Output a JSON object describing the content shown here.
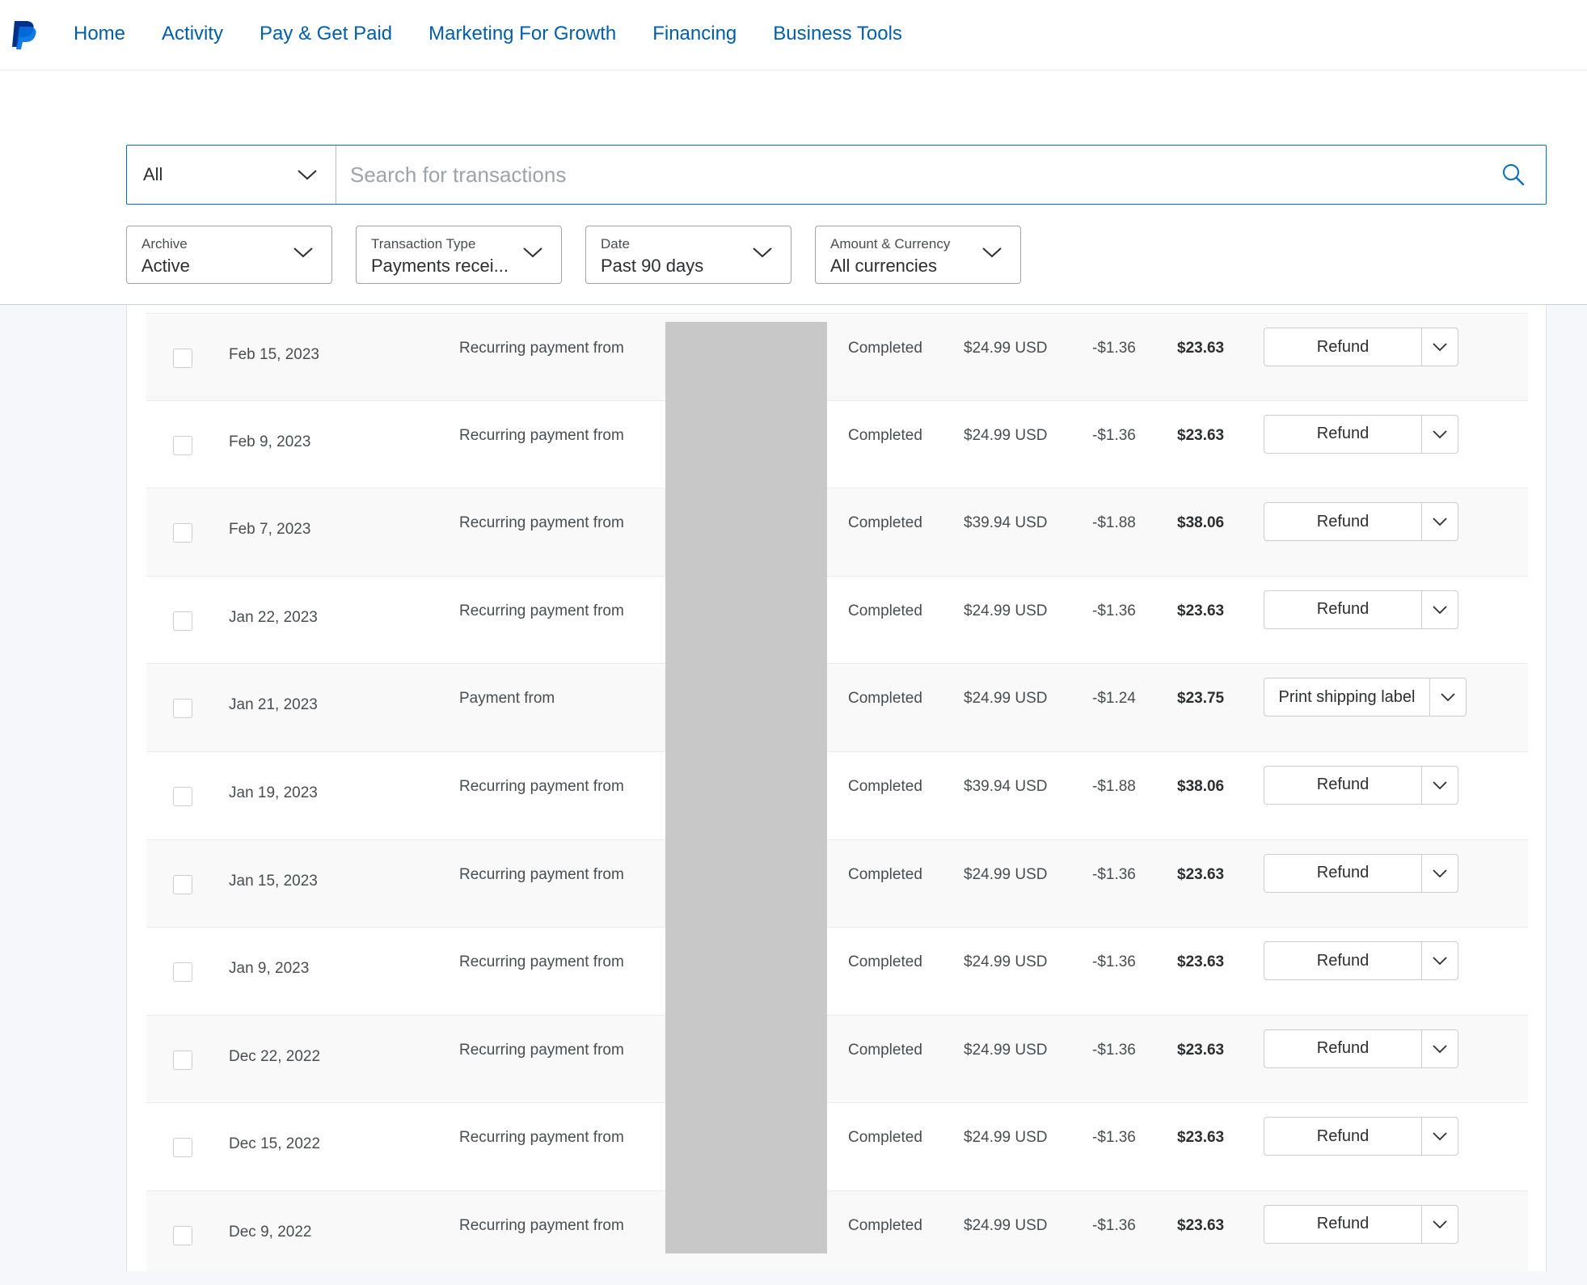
{
  "nav": {
    "logo": "paypal-logo",
    "links": [
      "Home",
      "Activity",
      "Pay & Get Paid",
      "Marketing For Growth",
      "Financing",
      "Business Tools"
    ]
  },
  "search": {
    "scope": "All",
    "placeholder": "Search for transactions"
  },
  "filters": [
    {
      "label": "Archive",
      "value": "Active"
    },
    {
      "label": "Transaction Type",
      "value": "Payments recei..."
    },
    {
      "label": "Date",
      "value": "Past 90 days"
    },
    {
      "label": "Amount & Currency",
      "value": "All currencies"
    }
  ],
  "colors": {
    "link": "#005ea6",
    "accent": "#0070ba",
    "redaction": "#c8c8c8"
  },
  "transactions": [
    {
      "date": "Feb 15, 2023",
      "description": "Recurring payment from",
      "status": "Completed",
      "gross": "$24.99 USD",
      "fee": "-$1.36",
      "net": "$23.63",
      "action": "Refund"
    },
    {
      "date": "Feb 9, 2023",
      "description": "Recurring payment from",
      "status": "Completed",
      "gross": "$24.99 USD",
      "fee": "-$1.36",
      "net": "$23.63",
      "action": "Refund"
    },
    {
      "date": "Feb 7, 2023",
      "description": "Recurring payment from",
      "status": "Completed",
      "gross": "$39.94 USD",
      "fee": "-$1.88",
      "net": "$38.06",
      "action": "Refund"
    },
    {
      "date": "Jan 22, 2023",
      "description": "Recurring payment from",
      "status": "Completed",
      "gross": "$24.99 USD",
      "fee": "-$1.36",
      "net": "$23.63",
      "action": "Refund"
    },
    {
      "date": "Jan 21, 2023",
      "description": "Payment from",
      "status": "Completed",
      "gross": "$24.99 USD",
      "fee": "-$1.24",
      "net": "$23.75",
      "action": "Print shipping label"
    },
    {
      "date": "Jan 19, 2023",
      "description": "Recurring payment from",
      "status": "Completed",
      "gross": "$39.94 USD",
      "fee": "-$1.88",
      "net": "$38.06",
      "action": "Refund"
    },
    {
      "date": "Jan 15, 2023",
      "description": "Recurring payment from",
      "status": "Completed",
      "gross": "$24.99 USD",
      "fee": "-$1.36",
      "net": "$23.63",
      "action": "Refund"
    },
    {
      "date": "Jan 9, 2023",
      "description": "Recurring payment from",
      "status": "Completed",
      "gross": "$24.99 USD",
      "fee": "-$1.36",
      "net": "$23.63",
      "action": "Refund"
    },
    {
      "date": "Dec 22, 2022",
      "description": "Recurring payment from",
      "status": "Completed",
      "gross": "$24.99 USD",
      "fee": "-$1.36",
      "net": "$23.63",
      "action": "Refund"
    },
    {
      "date": "Dec 15, 2022",
      "description": "Recurring payment from",
      "status": "Completed",
      "gross": "$24.99 USD",
      "fee": "-$1.36",
      "net": "$23.63",
      "action": "Refund"
    },
    {
      "date": "Dec 9, 2022",
      "description": "Recurring payment from",
      "status": "Completed",
      "gross": "$24.99 USD",
      "fee": "-$1.36",
      "net": "$23.63",
      "action": "Refund"
    }
  ]
}
